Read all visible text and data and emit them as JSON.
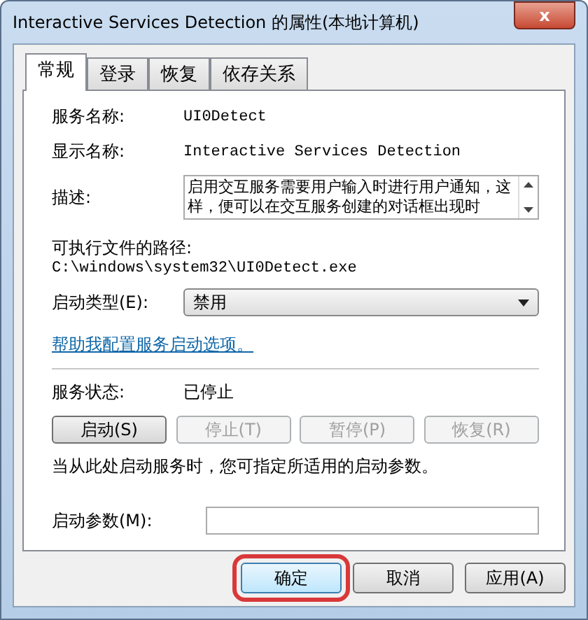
{
  "window": {
    "title": "Interactive Services Detection 的属性(本地计算机)",
    "close": "x"
  },
  "tabs": [
    {
      "label": "常规",
      "selected": true
    },
    {
      "label": "登录",
      "selected": false
    },
    {
      "label": "恢复",
      "selected": false
    },
    {
      "label": "依存关系",
      "selected": false
    }
  ],
  "service_name": {
    "label": "服务名称:",
    "value": "UI0Detect"
  },
  "display_name": {
    "label": "显示名称:",
    "value": "Interactive Services Detection"
  },
  "description": {
    "label": "描述:",
    "value": "启用交互服务需要用户输入时进行用户通知，这样，便可以在交互服务创建的对话框出现时"
  },
  "executable_path": {
    "label": "可执行文件的路径:",
    "value": "C:\\windows\\system32\\UI0Detect.exe"
  },
  "startup_type": {
    "label": "启动类型(E):",
    "value": "禁用"
  },
  "help_link": "帮助我配置服务启动选项。",
  "service_status": {
    "label": "服务状态:",
    "value": "已停止"
  },
  "service_buttons": [
    {
      "label": "启动(S)",
      "disabled": false
    },
    {
      "label": "停止(T)",
      "disabled": true
    },
    {
      "label": "暂停(P)",
      "disabled": true
    },
    {
      "label": "恢复(R)",
      "disabled": true
    }
  ],
  "hint": "当从此处启动服务时，您可指定所适用的启动参数。",
  "start_parameters": {
    "label": "启动参数(M):"
  },
  "dialog_buttons": [
    {
      "label": "确定",
      "highlighted": true
    },
    {
      "label": "取消",
      "highlighted": false
    },
    {
      "label": "应用(A)",
      "highlighted": false
    }
  ]
}
